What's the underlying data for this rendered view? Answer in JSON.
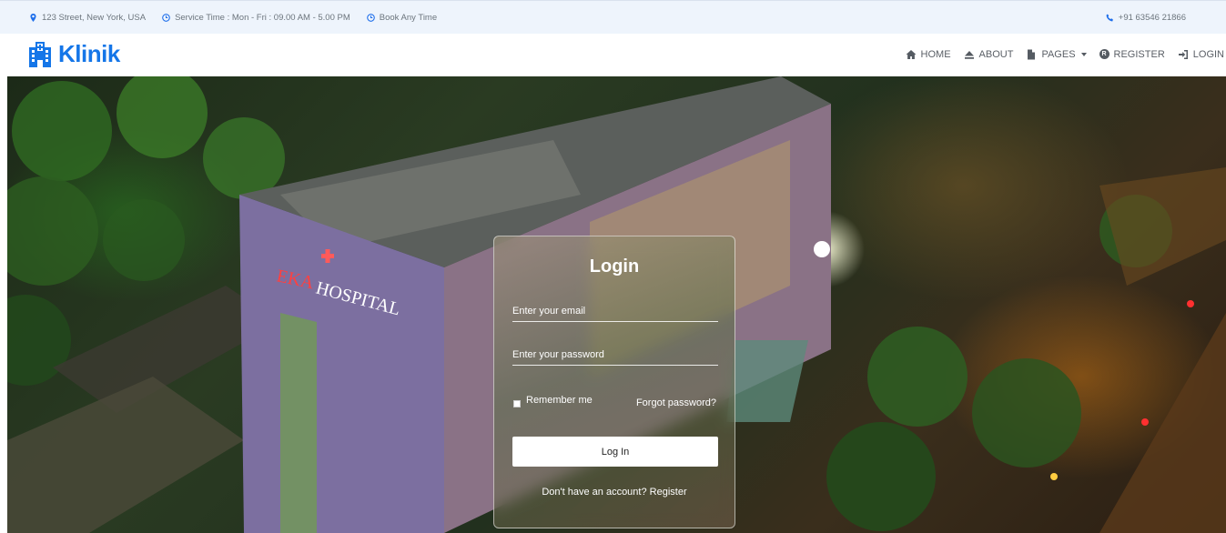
{
  "topbar": {
    "address": "123 Street, New York, USA",
    "service_time": "Service Time : Mon - Fri : 09.00 AM - 5.00 PM",
    "book": "Book Any Time",
    "phone": "+91 63546 21866",
    "icons": [
      "map-marker-icon",
      "clock-icon",
      "clock-icon",
      "phone-icon"
    ]
  },
  "navbar": {
    "brand": "Klinik",
    "brand_icon": "hospital-building-icon",
    "items": [
      {
        "label": "HOME",
        "icon": "home-icon"
      },
      {
        "label": "ABOUT",
        "icon": "eject-icon"
      },
      {
        "label": "PAGES",
        "icon": "file-icon"
      },
      {
        "label": "REGISTER",
        "icon": "registered-icon"
      },
      {
        "label": "LOGIN",
        "icon": "sign-in-icon"
      }
    ]
  },
  "login": {
    "title": "Login",
    "email_placeholder": "Enter your email",
    "password_placeholder": "Enter your password",
    "remember_label": "Remember me",
    "forgot_label": "Forgot password?",
    "button_label": "Log In",
    "register_prompt": "Don't have an account?",
    "register_link": "Register"
  },
  "hero": {
    "sign_text": "EKA HOSPITAL"
  },
  "colors": {
    "brand": "#1576e8",
    "topbar_bg": "#eef4fc",
    "nav_text": "#5a5f66"
  }
}
